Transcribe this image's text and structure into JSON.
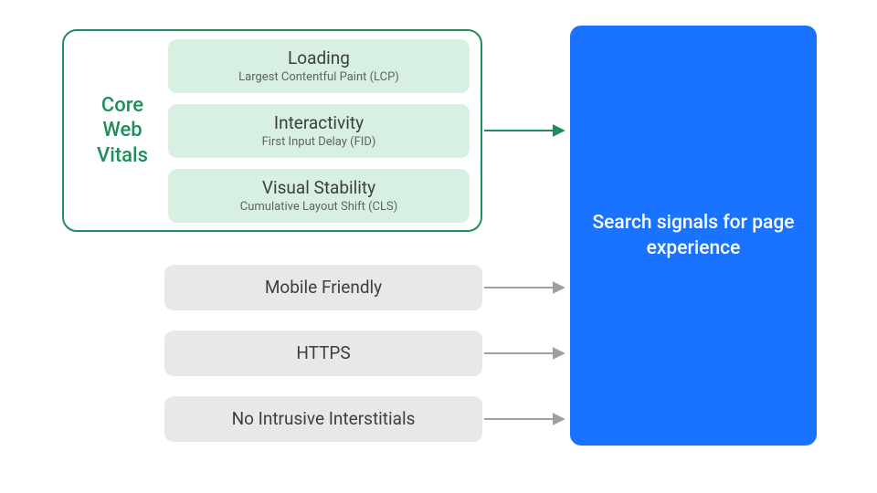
{
  "vitals": {
    "label_line1": "Core",
    "label_line2": "Web",
    "label_line3": "Vitals",
    "items": [
      {
        "title": "Loading",
        "subtitle": "Largest Contentful Paint (LCP)"
      },
      {
        "title": "Interactivity",
        "subtitle": "First Input Delay (FID)"
      },
      {
        "title": "Visual Stability",
        "subtitle": "Cumulative Layout Shift (CLS)"
      }
    ]
  },
  "other_signals": [
    {
      "title": "Mobile Friendly"
    },
    {
      "title": "HTTPS"
    },
    {
      "title": "No Intrusive Interstitials"
    }
  ],
  "target": {
    "text": "Search signals for page experience"
  },
  "colors": {
    "vitals_border": "#1e8e5a",
    "vitals_pill_bg": "#d7f0e1",
    "grey_pill_bg": "#e8e8e8",
    "target_bg": "#1a73ff",
    "arrow_green": "#1e8e5a",
    "arrow_grey": "#9aa0a6"
  }
}
